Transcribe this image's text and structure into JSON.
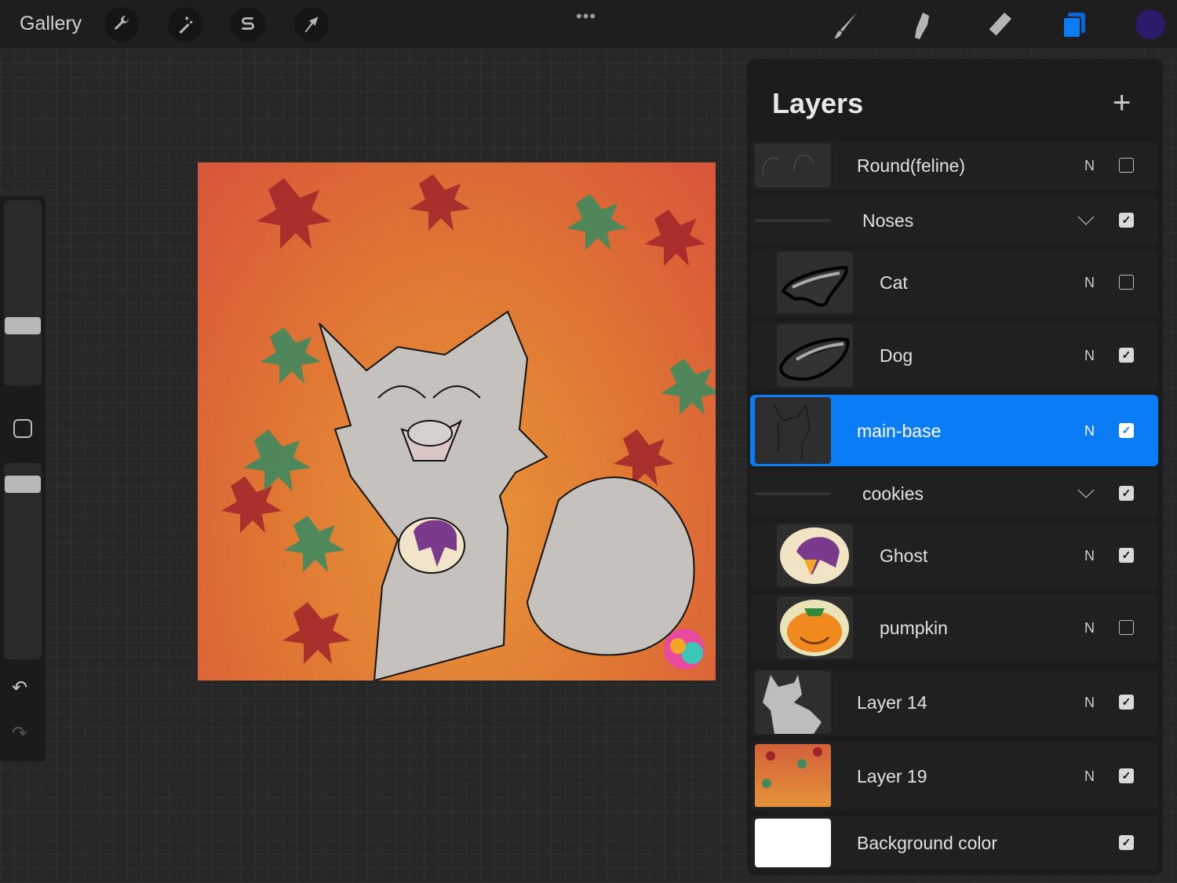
{
  "topbar": {
    "gallery": "Gallery",
    "more": "•••",
    "tools": [
      "wrench-icon",
      "magic-wand-icon",
      "selection-icon",
      "transform-arrow-icon"
    ],
    "right_tools": [
      "brush-icon",
      "smudge-icon",
      "eraser-icon",
      "layers-icon"
    ],
    "color": "#2e1a6b"
  },
  "panel": {
    "title": "Layers",
    "add": "+"
  },
  "layers": [
    {
      "name": "Round(feline)",
      "type": "layer",
      "mode": "N",
      "visible": false,
      "thumb": "sketch"
    },
    {
      "name": "Noses",
      "type": "group",
      "visible": true
    },
    {
      "name": "Cat",
      "type": "layer",
      "mode": "N",
      "visible": false,
      "thumb": "nose-cat",
      "indent": true
    },
    {
      "name": "Dog",
      "type": "layer",
      "mode": "N",
      "visible": true,
      "thumb": "nose-dog",
      "indent": true
    },
    {
      "name": "main-base",
      "type": "layer",
      "mode": "N",
      "visible": true,
      "thumb": "lineart",
      "selected": true
    },
    {
      "name": "cookies",
      "type": "group",
      "visible": true
    },
    {
      "name": "Ghost",
      "type": "layer",
      "mode": "N",
      "visible": true,
      "thumb": "ghost",
      "indent": true
    },
    {
      "name": "pumpkin",
      "type": "layer",
      "mode": "N",
      "visible": false,
      "thumb": "pumpkin",
      "indent": true
    },
    {
      "name": "Layer 14",
      "type": "layer",
      "mode": "N",
      "visible": true,
      "thumb": "silhouette"
    },
    {
      "name": "Layer 19",
      "type": "layer",
      "mode": "N",
      "visible": true,
      "thumb": "leaves"
    },
    {
      "name": "Background color",
      "type": "bg",
      "visible": true,
      "thumb": "white"
    }
  ],
  "colors": {
    "accent": "#0a7cf5"
  }
}
